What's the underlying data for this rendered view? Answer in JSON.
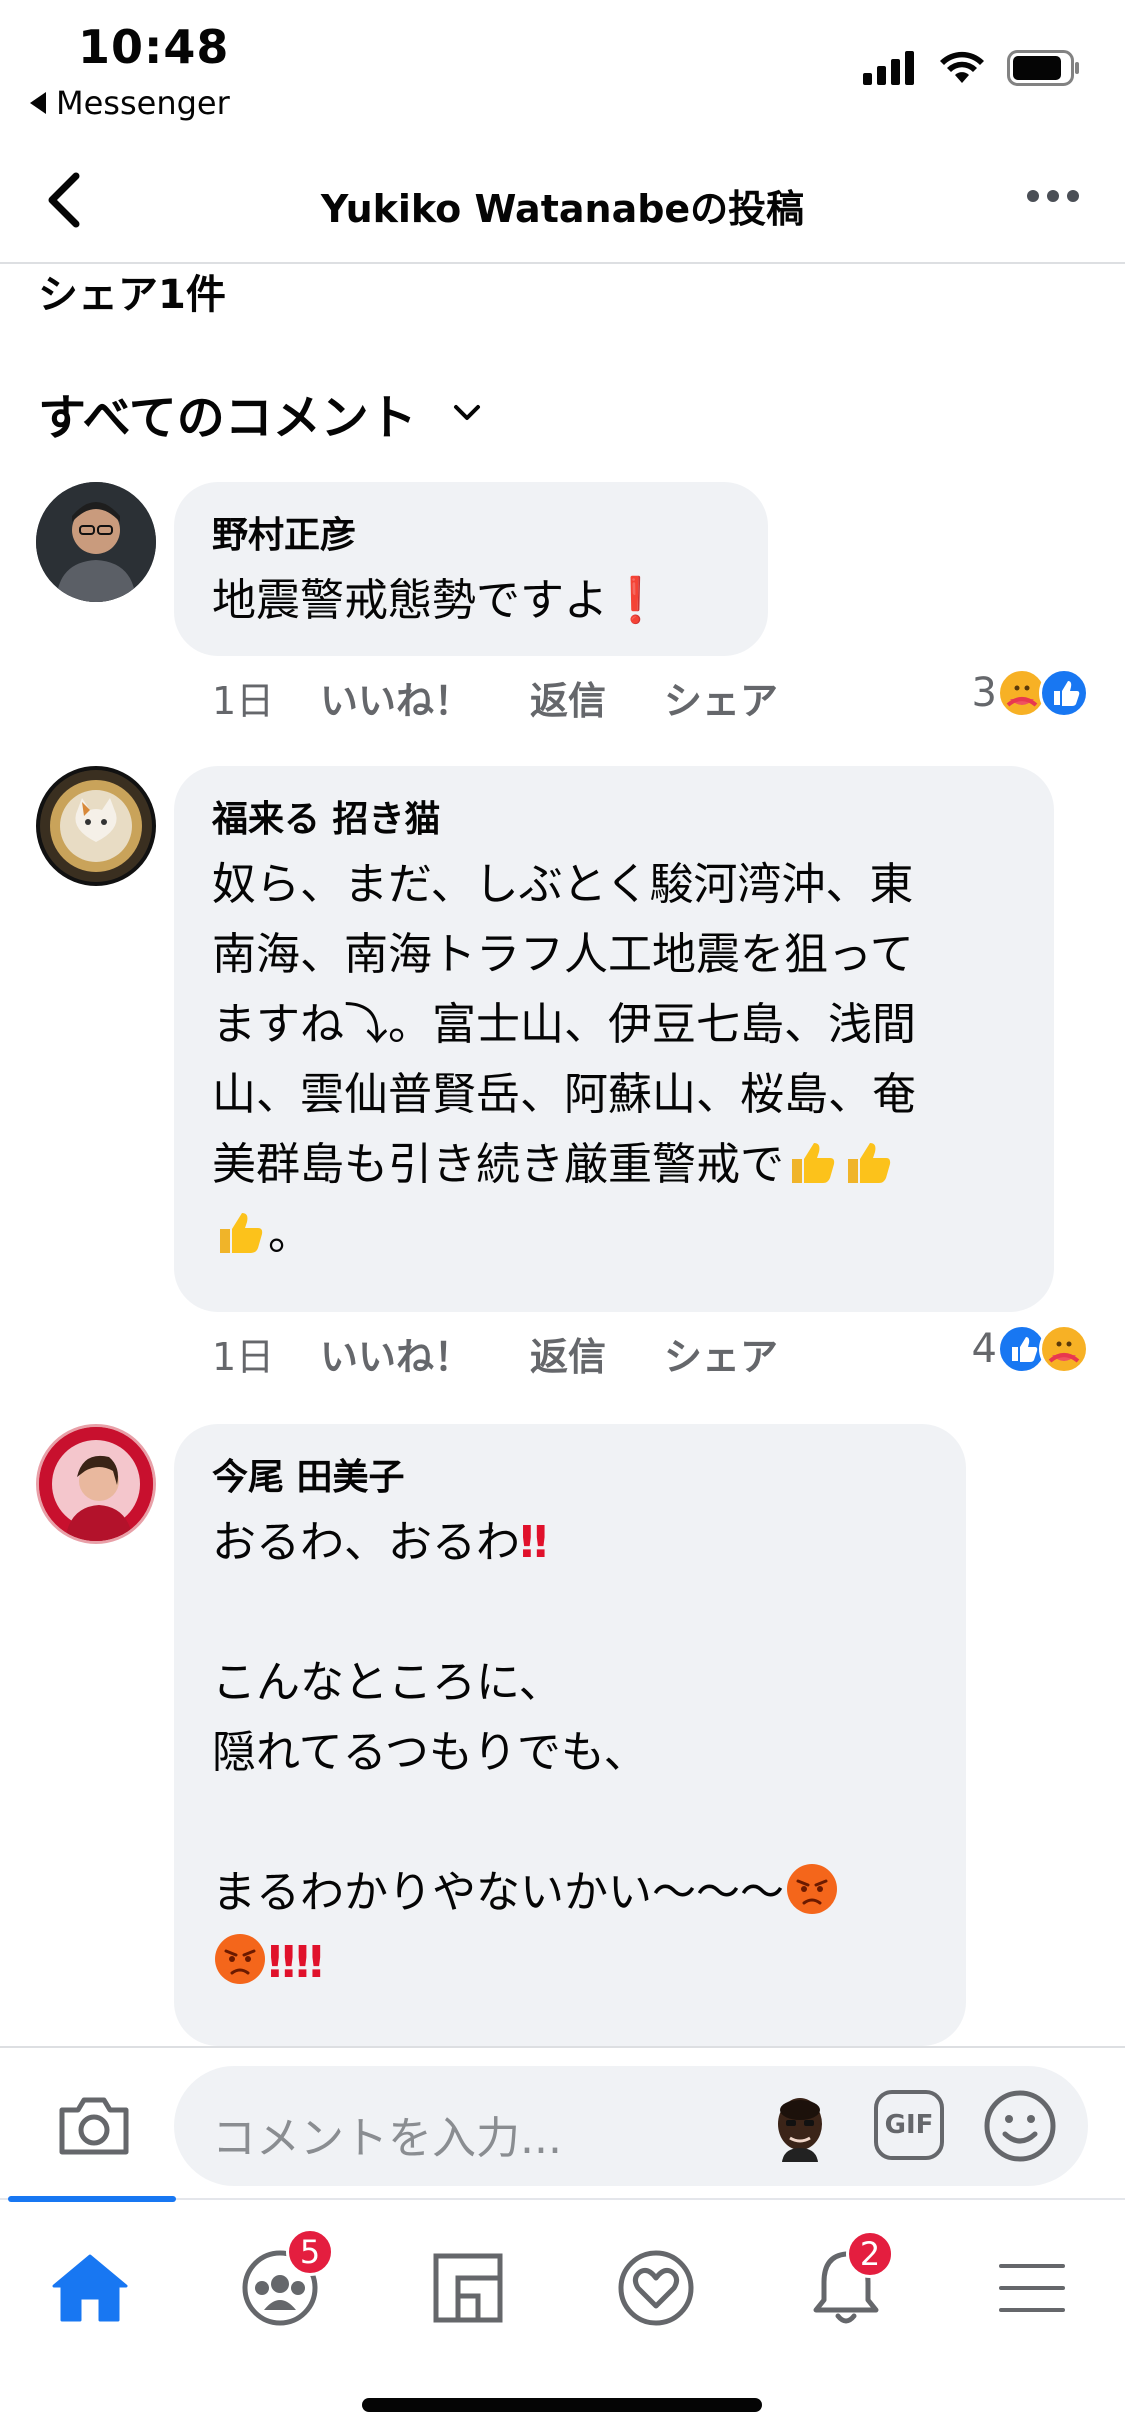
{
  "status_bar": {
    "time": "10:48",
    "back_app": "Messenger"
  },
  "header": {
    "title": "Yukiko Watanabeの投稿"
  },
  "post": {
    "share_count": "シェア1件",
    "comments_filter": "すべてのコメント"
  },
  "actions": {
    "like": "いいね！",
    "reply": "返信",
    "share": "シェア"
  },
  "comments": [
    {
      "author": "野村正彦",
      "text": "地震警戒態勢ですよ",
      "age": "1日",
      "reaction_count": "3",
      "reactions": [
        "care",
        "like"
      ]
    },
    {
      "author": "福来る 招き猫",
      "text_lines": [
        "奴ら、まだ、しぶとく駿河湾沖、東",
        "南海、南海トラフ人工地震を狙って",
        "ますね⤵︎。富士山、伊豆七島、浅間",
        "山、雲仙普賢岳、阿蘇山、桜島、奄",
        "美群島も引き続き厳重警戒で"
      ],
      "text_end": "。",
      "age": "1日",
      "reaction_count": "4",
      "reactions": [
        "like",
        "care"
      ]
    },
    {
      "author": "今尾 田美子",
      "lines": [
        "おるわ、おるわ",
        "",
        "こんなところに、",
        "隠れてるつもりでも、",
        "",
        "まるわかりやないかい〜〜〜"
      ]
    }
  ],
  "composer": {
    "placeholder": "コメントを入力...",
    "gif_label": "GIF"
  },
  "tabs": {
    "groups_badge": "5",
    "notifications_badge": "2",
    "items": [
      "home-tab",
      "groups-tab",
      "feeds-tab",
      "dating-tab",
      "notifications-tab",
      "menu-tab"
    ]
  },
  "colors": {
    "accent": "#1877f2",
    "bubble": "#f0f2f5",
    "badge": "#e41e3f",
    "secondary_text": "#65676b"
  }
}
